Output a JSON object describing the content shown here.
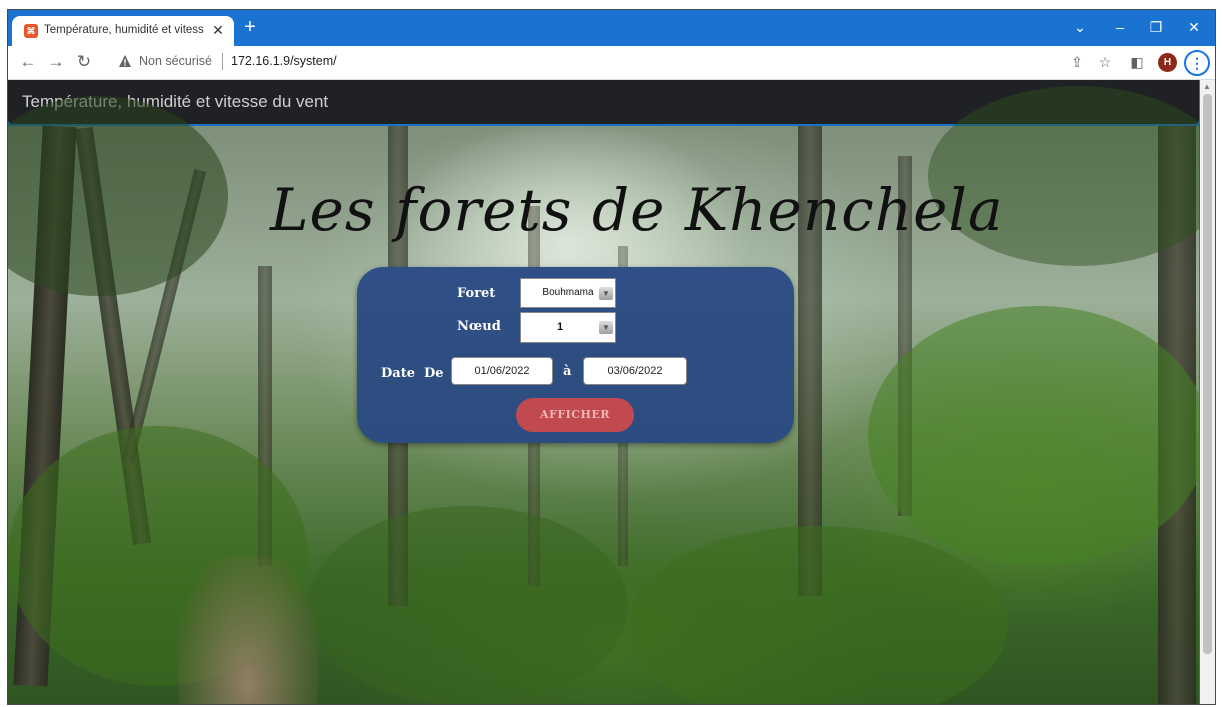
{
  "browser": {
    "tab_title": "Température, humidité et vitesse",
    "tab_favicon_label": "⌘",
    "new_tab_label": "+",
    "security_label": "Non sécurisé",
    "url": "172.16.1.9/system/",
    "profile_initial": "H",
    "accent_color": "#1a73d0"
  },
  "site": {
    "header_title": "Température, humidité et vitesse du vent",
    "heading": "Les forets de Khenchela"
  },
  "form": {
    "foret_label": "Foret",
    "foret_value": "Bouhmama",
    "noeud_label": "Nœud",
    "noeud_value": "1",
    "date_label": "Date  De",
    "date_from": "01/06/2022",
    "separator": "à",
    "date_to": "03/06/2022",
    "submit_label": "AFFICHER",
    "panel_color": "#2f4f86",
    "button_color": "#c14a50"
  }
}
